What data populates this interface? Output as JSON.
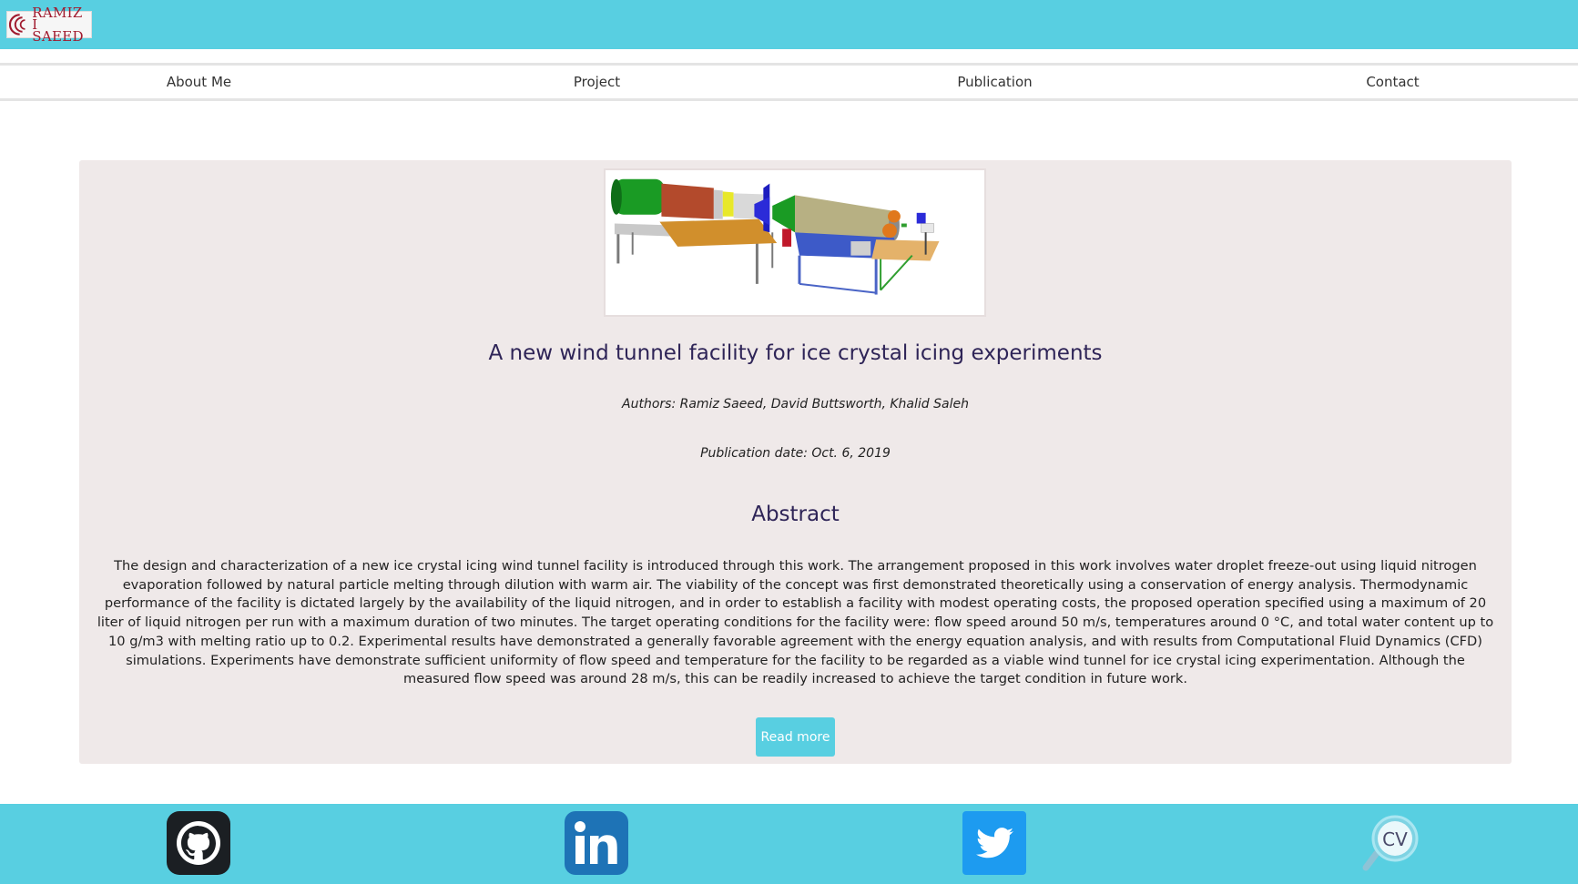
{
  "header": {
    "logo_text_line1": "RAMIZ I",
    "logo_text_line2": "SAEED"
  },
  "nav": {
    "items": [
      {
        "label": "About Me"
      },
      {
        "label": "Project"
      },
      {
        "label": "Publication"
      },
      {
        "label": "Contact"
      }
    ]
  },
  "publication": {
    "title": "A new wind tunnel facility for ice crystal icing experiments",
    "authors": "Authors: Ramiz Saeed, David Buttsworth, Khalid Saleh",
    "date": "Publication date: Oct. 6, 2019",
    "abstract_heading": "Abstract",
    "abstract": "The design and characterization of a new ice crystal icing wind tunnel facility is introduced through this work. The arrangement proposed in this work involves water droplet freeze-out using liquid nitrogen evaporation followed by natural particle melting through dilution with warm air. The viability of the concept was first demonstrated theoretically using a conservation of energy analysis. Thermodynamic performance of the facility is dictated largely by the availability of the liquid nitrogen, and in order to establish a facility with modest operating costs, the proposed operation specified using a maximum of 20 liter of liquid nitrogen per run with a maximum duration of two minutes. The target operating conditions for the facility were: flow speed around 50 m/s, temperatures around 0 °C, and total water content up to 10 g/m3 with melting ratio up to 0.2. Experimental results have demonstrated a generally favorable agreement with the energy equation analysis, and with results from Computational Fluid Dynamics (CFD) simulations. Experiments have demonstrate sufficient uniformity of flow speed and temperature for the facility to be regarded as a viable wind tunnel for ice crystal icing experimentation. Although the measured flow speed was around 28 m/s, this can be readily increased to achieve the target condition in future work.",
    "read_more_label": "Read more"
  },
  "footer": {
    "cv_label": "CV",
    "icons": [
      "github-icon",
      "linkedin-icon",
      "twitter-icon",
      "cv-icon"
    ]
  },
  "colors": {
    "accent": "#58cfe1",
    "card_bg": "#efe9e9",
    "heading": "#2e2457",
    "logo_red": "#a01a2e"
  }
}
